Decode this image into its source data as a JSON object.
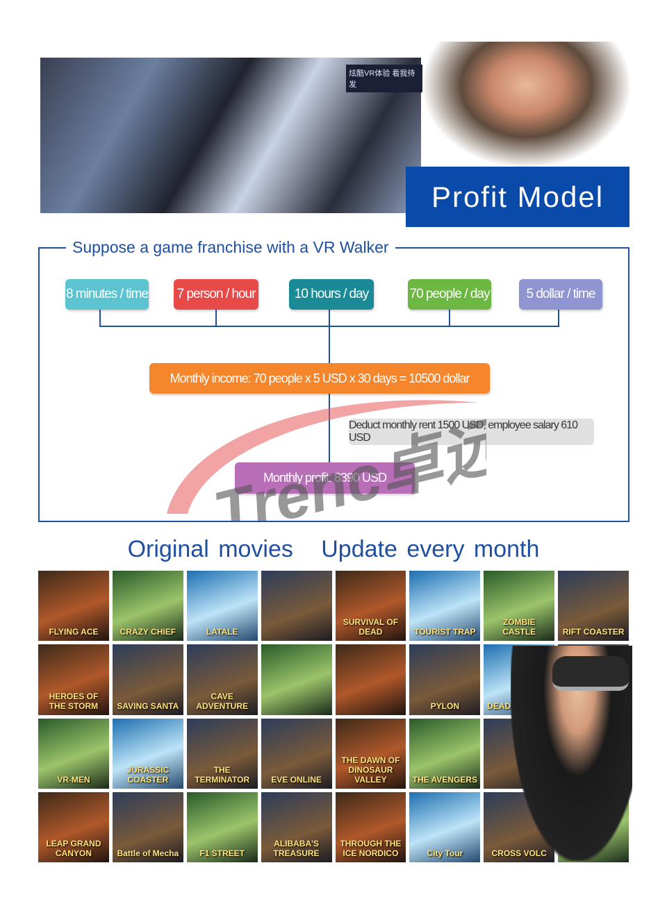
{
  "top": {
    "expo_sign": "炫酷VR体验 看我待发",
    "banner_title": "Profit Model"
  },
  "scheme": {
    "title": "Suppose a game franchise with a VR Walker",
    "factors": [
      {
        "label": "8 minutes / time",
        "color": "#5bc4d0"
      },
      {
        "label": "7 person / hour",
        "color": "#e84a4a"
      },
      {
        "label": "10 hours / day",
        "color": "#1a8a96"
      },
      {
        "label": "70 people / day",
        "color": "#6cb842"
      },
      {
        "label": "5 dollar / time",
        "color": "#8e95d0"
      }
    ],
    "income": {
      "label": "Monthly income: 70 people x 5 USD x 30 days = 10500 dollar",
      "color": "#f5862c"
    },
    "deduct": {
      "label": "Deduct monthly rent 1500 USD, employee salary 610 USD",
      "color": "#e0e0e0"
    },
    "profit": {
      "label": "Monthly profit: 8390 USD",
      "color": "#b86fb8"
    },
    "watermark": "Trenc卓远"
  },
  "movies": {
    "headline": "Original movies   Update every month",
    "tiles": [
      "FLYING ACE",
      "CRAZY CHIEF",
      "LATALE",
      "",
      "SURVIVAL OF DEAD",
      "TOURIST TRAP",
      "ZOMBIE CASTLE",
      "RIFT COASTER",
      "HEROES OF THE STORM",
      "SAVING SANTA",
      "CAVE ADVENTURE",
      "",
      "",
      "PYLON",
      "DEAD TRIGGER",
      "",
      "VR-MEN",
      "JURASSIC COASTER",
      "THE TERMINATOR",
      "EVE ONLINE",
      "THE DAWN OF DINOSAUR VALLEY",
      "THE AVENGERS",
      "",
      "",
      "LEAP GRAND CANYON",
      "Battle of Mecha",
      "F1 STREET",
      "ALIBABA'S TREASURE",
      "THROUGH THE ICE NORDICO",
      "City Tour",
      "CROSS VOLC",
      ""
    ]
  },
  "accent": "#1e4fa0"
}
